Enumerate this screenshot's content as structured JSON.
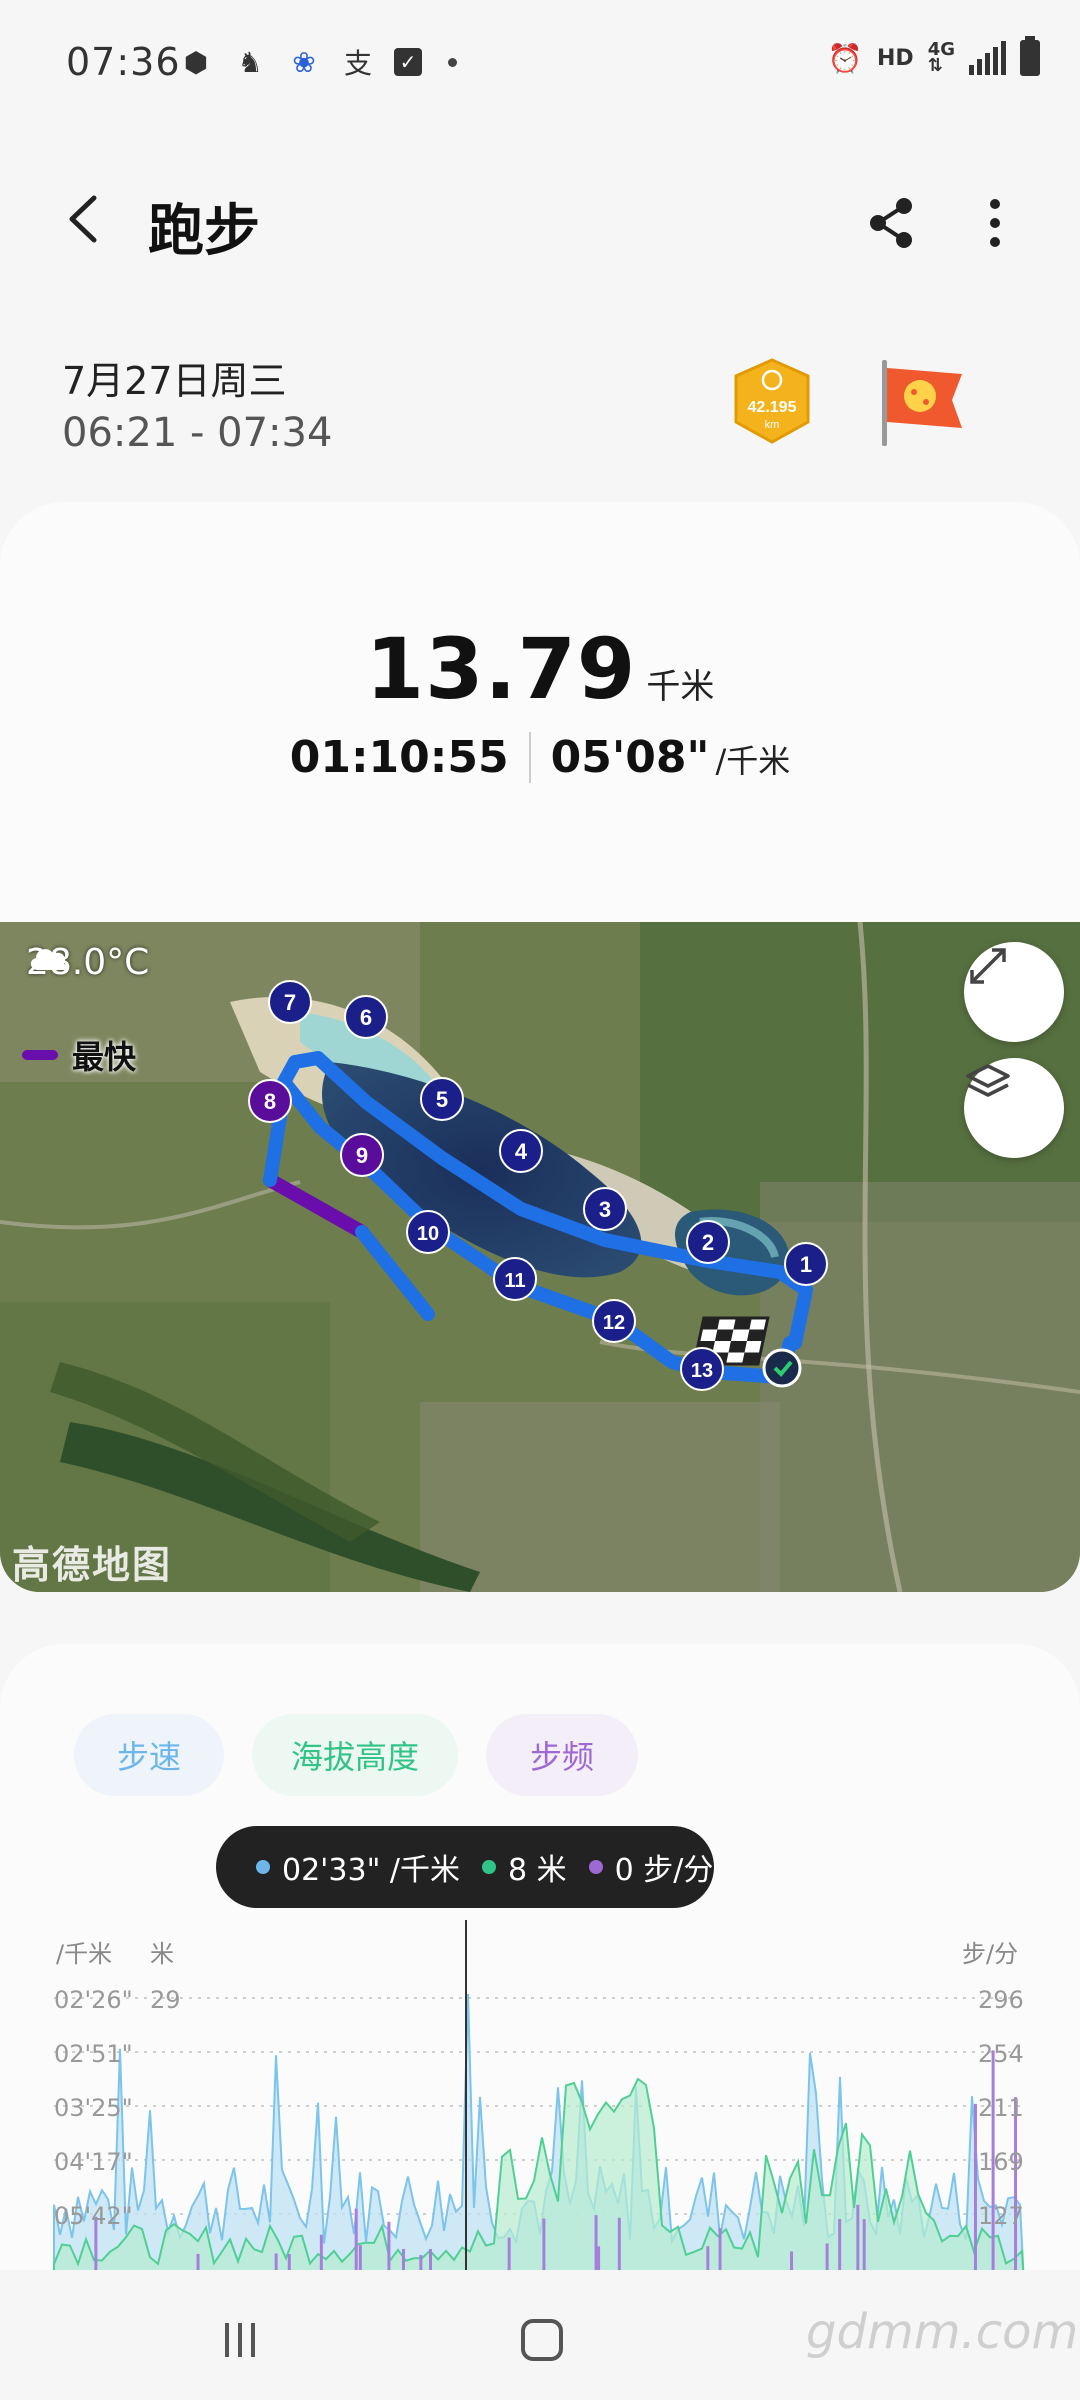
{
  "status_bar": {
    "time": "07:36",
    "network_hd": "HD",
    "network_type": "4G"
  },
  "app_bar": {
    "title": "跑步"
  },
  "workout": {
    "date": "7月27日周三",
    "time_range": "06:21 - 07:34",
    "medal_text": "42.195",
    "medal_unit": "km"
  },
  "summary": {
    "distance": "13.79",
    "distance_unit": "千米",
    "duration": "01:10:55",
    "pace": "05'08\"",
    "pace_unit": "/千米"
  },
  "map": {
    "temperature": "28.0°C",
    "legend_fastest": "最快",
    "provider_logo": "高德地图",
    "markers": [
      "1",
      "2",
      "3",
      "4",
      "5",
      "6",
      "7",
      "8",
      "9",
      "10",
      "11",
      "12",
      "13"
    ]
  },
  "chart": {
    "tabs": [
      {
        "label": "步速",
        "color": "#6cb6ea"
      },
      {
        "label": "海拔高度",
        "color": "#31c487"
      },
      {
        "label": "步频",
        "color": "#9e69d3"
      }
    ],
    "tooltip": {
      "pace": "02'33\" /千米",
      "altitude": "8 米",
      "cadence": "0 步/分"
    },
    "left_unit_pace": "/千米",
    "left_unit_alt": "米",
    "right_unit": "步/分",
    "pace_ticks": [
      "02'26\"",
      "02'51\"",
      "03'25\"",
      "04'17\"",
      "05'42\""
    ],
    "alt_ticks": [
      "29"
    ],
    "cadence_ticks": [
      "296",
      "254",
      "211",
      "169",
      "127"
    ]
  },
  "watermark": "gdmm.com"
}
